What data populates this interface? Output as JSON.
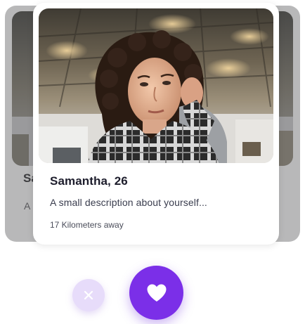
{
  "back_card": {
    "name": "Sa",
    "description": "A"
  },
  "profile_card": {
    "name_age": "Samantha, 26",
    "description": "A small description about yourself...",
    "distance": "17 Kilometers away"
  },
  "actions": {
    "dislike_icon": "close-icon",
    "like_icon": "heart-icon"
  },
  "colors": {
    "accent": "#7b2fe8",
    "dislike_bg": "#e7dcfa",
    "dislike_icon": "#ffffff",
    "back_card": "#b8b8b9"
  }
}
